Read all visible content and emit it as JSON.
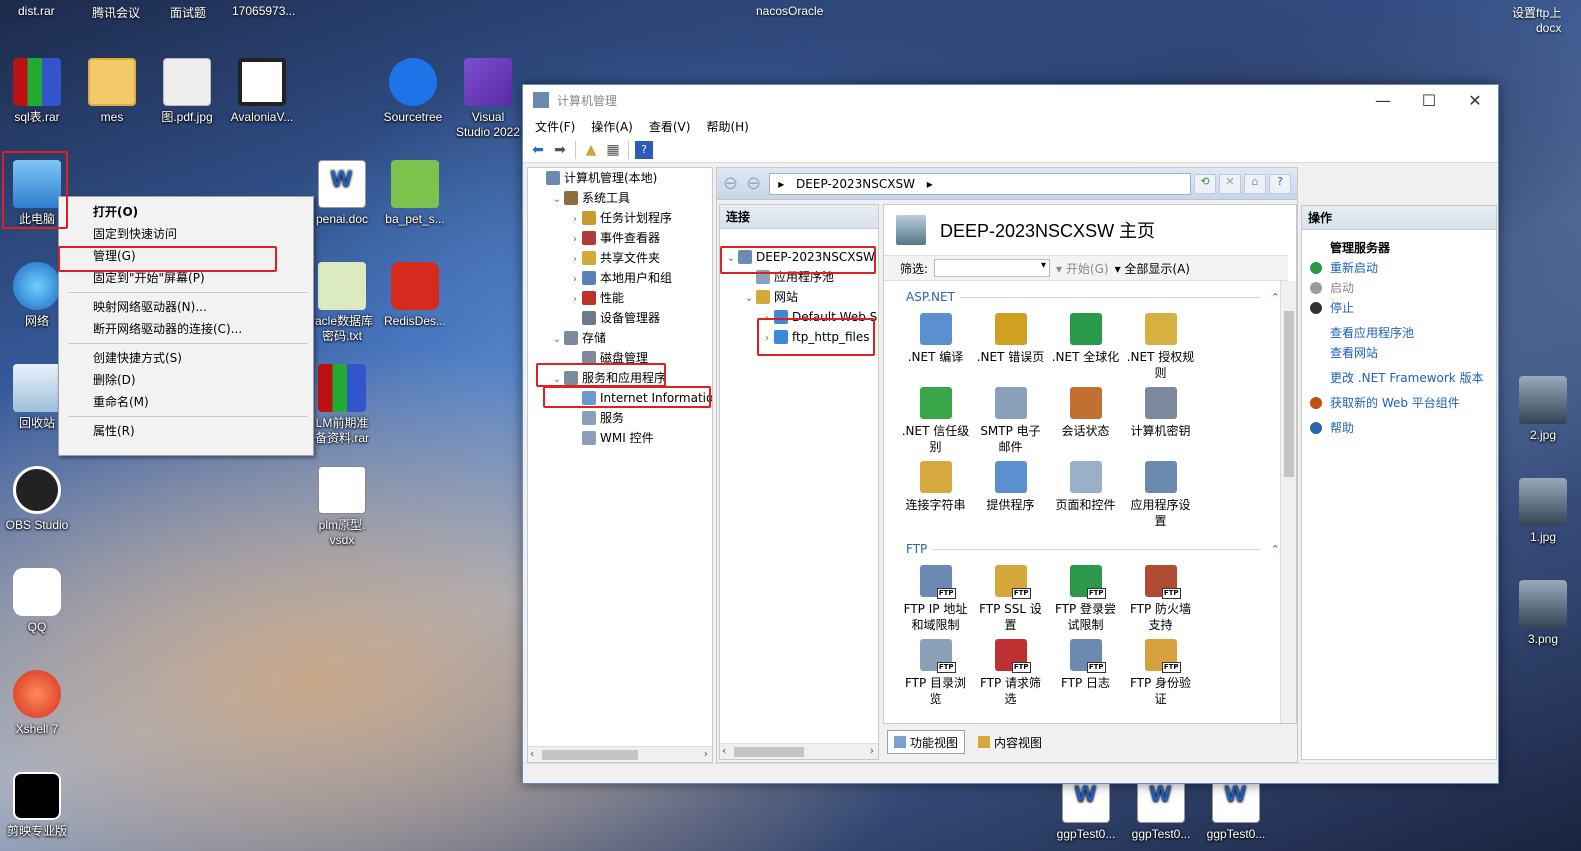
{
  "taskbar_top_labels": [
    "dist.rar",
    "腾讯会议",
    "面试题",
    "17065973...",
    "nacosOracle"
  ],
  "top_right_label": "设置ftp上\ndocx",
  "desktop": {
    "icons": [
      {
        "label": "sql表.rar",
        "icon": "winrar-icon"
      },
      {
        "label": "mes",
        "icon": "folder-icon"
      },
      {
        "label": "图.pdf.jpg",
        "icon": "image-file-icon"
      },
      {
        "label": "AvaloniaV...",
        "icon": "avalonia-icon"
      },
      {
        "label": "Sourcetree",
        "icon": "sourcetree-icon"
      },
      {
        "label": "Visual\nStudio 2022",
        "icon": "visual-studio-icon"
      },
      {
        "label": "此电脑",
        "icon": "this-pc-icon"
      },
      {
        "label": "网络",
        "icon": "network-icon"
      },
      {
        "label": "回收站",
        "icon": "recycle-bin-icon"
      },
      {
        "label": "OBS Studio",
        "icon": "obs-icon"
      },
      {
        "label": "QQ",
        "icon": "qq-icon"
      },
      {
        "label": "Xshell 7",
        "icon": "xshell-icon"
      },
      {
        "label": "剪映专业版",
        "icon": "capcut-icon"
      },
      {
        "label": "penai.doc",
        "icon": "word-doc-icon"
      },
      {
        "label": "ba_pet_s...",
        "icon": "notepad-plus-icon"
      },
      {
        "label": "racle数据库\n密码.txt",
        "icon": "text-file-icon"
      },
      {
        "label": "RedisDes...",
        "icon": "redis-icon"
      },
      {
        "label": "LM前期准\n备资料.rar",
        "icon": "winrar-icon"
      },
      {
        "label": "plm原型.\nvsdx",
        "icon": "visio-file-icon"
      },
      {
        "label": "2.jpg",
        "icon": "image-thumb-icon"
      },
      {
        "label": "1.jpg",
        "icon": "image-thumb-icon"
      },
      {
        "label": "3.png",
        "icon": "image-thumb-icon"
      },
      {
        "label": "ggpTest0...",
        "icon": "word-doc-icon"
      },
      {
        "label": "ggpTest0...",
        "icon": "word-doc-icon"
      },
      {
        "label": "ggpTest0...",
        "icon": "word-doc-icon"
      }
    ]
  },
  "context_menu": {
    "items": [
      {
        "label": "打开(O)",
        "bold": true
      },
      {
        "label": "固定到快速访问"
      },
      {
        "label": "管理(G)"
      },
      {
        "label": "固定到\"开始\"屏幕(P)"
      },
      {
        "sep": true
      },
      {
        "label": "映射网络驱动器(N)..."
      },
      {
        "label": "断开网络驱动器的连接(C)..."
      },
      {
        "sep": true
      },
      {
        "label": "创建快捷方式(S)"
      },
      {
        "label": "删除(D)"
      },
      {
        "label": "重命名(M)"
      },
      {
        "sep": true
      },
      {
        "label": "属性(R)"
      }
    ]
  },
  "window": {
    "title": "计算机管理",
    "controls": {
      "minimize": "—",
      "maximize": "☐",
      "close": "✕"
    },
    "menu": [
      "文件(F)",
      "操作(A)",
      "查看(V)",
      "帮助(H)"
    ],
    "tree": [
      {
        "label": "计算机管理(本地)",
        "depth": 0,
        "arrow": "",
        "color": "#6b8bb5"
      },
      {
        "label": "系统工具",
        "depth": 1,
        "arrow": "⌄",
        "color": "#8a6d3b"
      },
      {
        "label": "任务计划程序",
        "depth": 2,
        "arrow": "›",
        "color": "#c79a2a"
      },
      {
        "label": "事件查看器",
        "depth": 2,
        "arrow": "›",
        "color": "#b23a3a"
      },
      {
        "label": "共享文件夹",
        "depth": 2,
        "arrow": "›",
        "color": "#d6a83a"
      },
      {
        "label": "本地用户和组",
        "depth": 2,
        "arrow": "›",
        "color": "#5b7fb8"
      },
      {
        "label": "性能",
        "depth": 2,
        "arrow": "›",
        "color": "#c0302a"
      },
      {
        "label": "设备管理器",
        "depth": 2,
        "arrow": "",
        "color": "#6b7a8c"
      },
      {
        "label": "存储",
        "depth": 1,
        "arrow": "⌄",
        "color": "#7b8a9c"
      },
      {
        "label": "磁盘管理",
        "depth": 2,
        "arrow": "",
        "color": "#7b8a9c"
      },
      {
        "label": "服务和应用程序",
        "depth": 1,
        "arrow": "⌄",
        "color": "#7b8a9c"
      },
      {
        "label": "Internet Information S",
        "depth": 2,
        "arrow": "",
        "color": "#6a9ad0"
      },
      {
        "label": "服务",
        "depth": 2,
        "arrow": "",
        "color": "#8ba0b8"
      },
      {
        "label": "WMI 控件",
        "depth": 2,
        "arrow": "",
        "color": "#8ba0b8"
      }
    ],
    "iis": {
      "address": "DEEP-2023NSCXSW",
      "address_sep": "▸",
      "connections_title": "连接",
      "conn_tree": [
        {
          "label": "DEEP-2023NSCXSW",
          "depth": 0,
          "arrow": "⌄",
          "color": "#6b8bb5"
        },
        {
          "label": "应用程序池",
          "depth": 1,
          "arrow": "",
          "color": "#8aa0c0"
        },
        {
          "label": "网站",
          "depth": 1,
          "arrow": "⌄",
          "color": "#d6a83a"
        },
        {
          "label": "Default Web S",
          "depth": 2,
          "arrow": "›",
          "color": "#3a8ad6"
        },
        {
          "label": "ftp_http_files",
          "depth": 2,
          "arrow": "›",
          "color": "#3a8ad6"
        }
      ],
      "home_title": "DEEP-2023NSCXSW 主页",
      "filter_label": "筛选:",
      "filter_start": "▾ 开始(G)",
      "filter_showall": "▾ 全部显示(A)",
      "aspnet_title": "ASP.NET",
      "aspnet": [
        {
          "label": ".NET 编译",
          "icon": "net-compile-icon",
          "color": "#5a8fd0"
        },
        {
          "label": ".NET 错误页",
          "icon": "net-error-page-icon",
          "color": "#d0a020"
        },
        {
          "label": ".NET 全球化",
          "icon": "net-globalization-icon",
          "color": "#2a9a4a"
        },
        {
          "label": ".NET 授权规\n则",
          "icon": "net-auth-rules-icon",
          "color": "#d6b040"
        },
        {
          "label": ".NET 信任级\n别",
          "icon": "net-trust-level-icon",
          "color": "#3aa64a"
        },
        {
          "label": "SMTP 电子\n邮件",
          "icon": "smtp-email-icon",
          "color": "#8aa0b8"
        },
        {
          "label": "会话状态",
          "icon": "session-state-icon",
          "color": "#c07030"
        },
        {
          "label": "计算机密钥",
          "icon": "machine-key-icon",
          "color": "#7a8a9c"
        },
        {
          "label": "连接字符串",
          "icon": "connection-string-icon",
          "color": "#d6a840"
        },
        {
          "label": "提供程序",
          "icon": "providers-icon",
          "color": "#5a8fd0"
        },
        {
          "label": "页面和控件",
          "icon": "pages-controls-icon",
          "color": "#9ab0c8"
        },
        {
          "label": "应用程序设\n置",
          "icon": "app-settings-icon",
          "color": "#6a8ab0"
        }
      ],
      "ftp_title": "FTP",
      "ftp": [
        {
          "label": "FTP IP 地址\n和域限制",
          "icon": "ftp-ip-restrictions-icon",
          "color": "#6b8bb5"
        },
        {
          "label": "FTP SSL 设\n置",
          "icon": "ftp-ssl-icon",
          "color": "#d6a83a"
        },
        {
          "label": "FTP 登录尝\n试限制",
          "icon": "ftp-logon-attempt-icon",
          "color": "#2a9a4a"
        },
        {
          "label": "FTP 防火墙\n支持",
          "icon": "ftp-firewall-icon",
          "color": "#b04a30"
        },
        {
          "label": "FTP 目录浏\n览",
          "icon": "ftp-directory-browsing-icon",
          "color": "#8aa0b8"
        },
        {
          "label": "FTP 请求筛\n选",
          "icon": "ftp-request-filter-icon",
          "color": "#c03030"
        },
        {
          "label": "FTP 日志",
          "icon": "ftp-logging-icon",
          "color": "#6a8ab0"
        },
        {
          "label": "FTP 身份验\n证",
          "icon": "ftp-authentication-icon",
          "color": "#d6a040"
        }
      ],
      "view_tabs": [
        "功能视图",
        "内容视图"
      ]
    },
    "actions": {
      "title": "操作",
      "items": [
        {
          "label": "管理服务器",
          "type": "head"
        },
        {
          "label": "重新启动",
          "type": "link",
          "color": "#2a9a4a"
        },
        {
          "label": "启动",
          "type": "disabled",
          "color": "#999999"
        },
        {
          "label": "停止",
          "type": "link",
          "color": "#333333"
        },
        {
          "gap": true
        },
        {
          "label": "查看应用程序池",
          "type": "link"
        },
        {
          "label": "查看网站",
          "type": "link"
        },
        {
          "gap": true
        },
        {
          "label": "更改 .NET Framework 版本",
          "type": "link"
        },
        {
          "gap": true
        },
        {
          "label": "获取新的 Web 平台组件",
          "type": "link",
          "color": "#c05010"
        },
        {
          "gap": true
        },
        {
          "label": "帮助",
          "type": "link",
          "color": "#2a64b5"
        }
      ]
    }
  }
}
